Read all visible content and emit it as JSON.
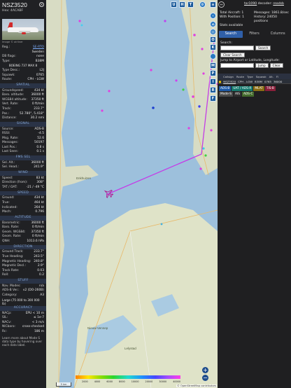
{
  "left": {
    "callsign": "NSZ3520",
    "hex": "Hex: 4ACABF",
    "photo_credit": "Image © airliner",
    "rows_top": [
      {
        "k": "Reg.:",
        "v": "SE-RTO",
        "link": true
      },
      {
        "k": "",
        "v": "Sweden",
        "link": false
      },
      {
        "k": "DB flags:",
        "v": "none",
        "link": false
      },
      {
        "k": "Type:",
        "v": "B38M",
        "link": false
      }
    ],
    "type_full": "BOEING 737 MAX 8",
    "rows_type": [
      {
        "k": "Type Desc.:",
        "v": "L2J"
      },
      {
        "k": "Squawk:",
        "v": "0765"
      },
      {
        "k": "Route:",
        "v": "CPH - LGW"
      }
    ],
    "spatial_title": "SPATIAL",
    "spatial": [
      {
        "k": "Groundspeed:",
        "v": "434 kt"
      },
      {
        "k": "Baro. altitude:",
        "v": "36000 ft"
      },
      {
        "k": "WGS84 altitude:",
        "v": "37350 ft"
      },
      {
        "k": "Vert. Rate:",
        "v": "0 ft/min"
      },
      {
        "k": "Track:",
        "v": "233.7°"
      },
      {
        "k": "Pos.:",
        "v": "52.780°, 5.418°"
      },
      {
        "k": "Distance:",
        "v": "30.2 nmi"
      }
    ],
    "signal_title": "SIGNAL",
    "signal": [
      {
        "k": "Source:",
        "v": "ADS-B"
      },
      {
        "k": "RSSI:",
        "v": "-4.5"
      },
      {
        "k": "Msg. Rate:",
        "v": "52.6"
      },
      {
        "k": "Messages:",
        "v": "50197"
      },
      {
        "k": "Last Pos.:",
        "v": "0.8 s"
      },
      {
        "k": "Last Seen:",
        "v": "0.1 s"
      }
    ],
    "fms_title": "FMS SEL",
    "fms": [
      {
        "k": "Sel. Alt.:",
        "v": "36000 ft"
      },
      {
        "k": "Sel. Head.:",
        "v": "241.9°"
      }
    ],
    "wind_title": "WIND",
    "wind": [
      {
        "k": "Speed:",
        "v": "83 kt"
      },
      {
        "k": "Direction (from):",
        "v": "308°"
      },
      {
        "k": "TAT / OAT:",
        "v": "-21 / -49 °C"
      }
    ],
    "speed_title": "SPEED",
    "speed": [
      {
        "k": "Ground:",
        "v": "434 kt"
      },
      {
        "k": "True:",
        "v": "464 kt"
      },
      {
        "k": "Indicated:",
        "v": "264 kt"
      },
      {
        "k": "Mach:",
        "v": "0.796"
      }
    ],
    "altitude_title": "ALTITUDE",
    "altitude": [
      {
        "k": "Barometric:",
        "v": "36000 ft"
      },
      {
        "k": "Baro. Rate:",
        "v": "0 ft/min"
      },
      {
        "k": "Geom. WGS84:",
        "v": "37350 ft"
      },
      {
        "k": "Geom. Rate:",
        "v": "0 ft/min"
      },
      {
        "k": "QNH:",
        "v": "1013.6 hPa"
      }
    ],
    "direction_title": "DIRECTION",
    "direction": [
      {
        "k": "Ground Track:",
        "v": "233.7°"
      },
      {
        "k": "True Heading:",
        "v": "243.5°"
      },
      {
        "k": "Magnetic Heading:",
        "v": "240.8°"
      },
      {
        "k": "Magnetic Decl.:",
        "v": "2.9°"
      },
      {
        "k": "Track Rate:",
        "v": "0.03"
      },
      {
        "k": "Roll:",
        "v": "0.2"
      }
    ],
    "stuff_title": "STUFF",
    "stuff": [
      {
        "k": "Nav. Modes:",
        "v": "n/a"
      },
      {
        "k": "ADS-B Ver.:",
        "v": "v2 (DO-260B)"
      },
      {
        "k": "Category:",
        "v": "A3"
      }
    ],
    "stuff_category_desc": "Large (75 000 to 300 000 lb)",
    "accuracy_title": "ACCURACY",
    "accuracy": [
      {
        "k": "NACp:",
        "v": "EPU < 10 m"
      },
      {
        "k": "SIL:",
        "v": "≤ 1e-7"
      },
      {
        "k": "NACv:",
        "v": "< 3 m/s"
      },
      {
        "k": "NICbaro:",
        "v": "cross-checked"
      },
      {
        "k": "Rc:",
        "v": "186 m"
      }
    ],
    "footer": "Learn more about Mode S data type by hovering over each data label."
  },
  "map": {
    "buttons_top": [
      "U",
      "H",
      "T"
    ],
    "buttons_side": [
      "O",
      "K",
      "M",
      "P",
      "I",
      "R",
      "F"
    ],
    "places": [
      "Enkhuizen",
      "Nieuw-Vennep",
      "Lelystad"
    ],
    "scale": "5 km",
    "altitude_ticks": [
      "",
      "2000",
      "4000",
      "6000",
      "8000",
      "10000",
      "20000",
      "30000",
      "40000"
    ],
    "attribution": "© OpenStreetMap contributors"
  },
  "right": {
    "version_name": "tar1090",
    "version_rest": " decoder: ",
    "version_link": "readsb",
    "stats": [
      "Total Aircraft: 1",
      "Messages: 1861.8/sec",
      "With Position: 1",
      "History: 24050 positions",
      "Stats available",
      ""
    ],
    "tabs": [
      "Search",
      "Filters",
      "Columns"
    ],
    "search_label": "Search:",
    "search_button": "Search",
    "clear_button": "Clear Search",
    "jump_label": "Jump to Airport or Latitude, Longitude:",
    "jump_button": "Jump",
    "jump_clear": "Clear",
    "columns": [
      "Callsign",
      "Route",
      "Type",
      "Squawk",
      "Alt.",
      "Fl"
    ],
    "row": [
      "NSZ3520",
      "CPH - LGW",
      "B38M",
      "0765",
      "36000"
    ],
    "legend": [
      {
        "label": "ADS-B",
        "color": "#1e5aa8"
      },
      {
        "label": "UAT / ADS-R",
        "color": "#167a6e"
      },
      {
        "label": "MLAT",
        "color": "#8a6d14"
      },
      {
        "label": "TIS-B",
        "color": "#8a1f3a"
      },
      {
        "label": "Mode-S",
        "color": "#4a4a4a"
      },
      {
        "label": "AIS",
        "color": "#2f2f2f"
      },
      {
        "label": "ADS-C",
        "color": "#446b2d"
      }
    ]
  }
}
